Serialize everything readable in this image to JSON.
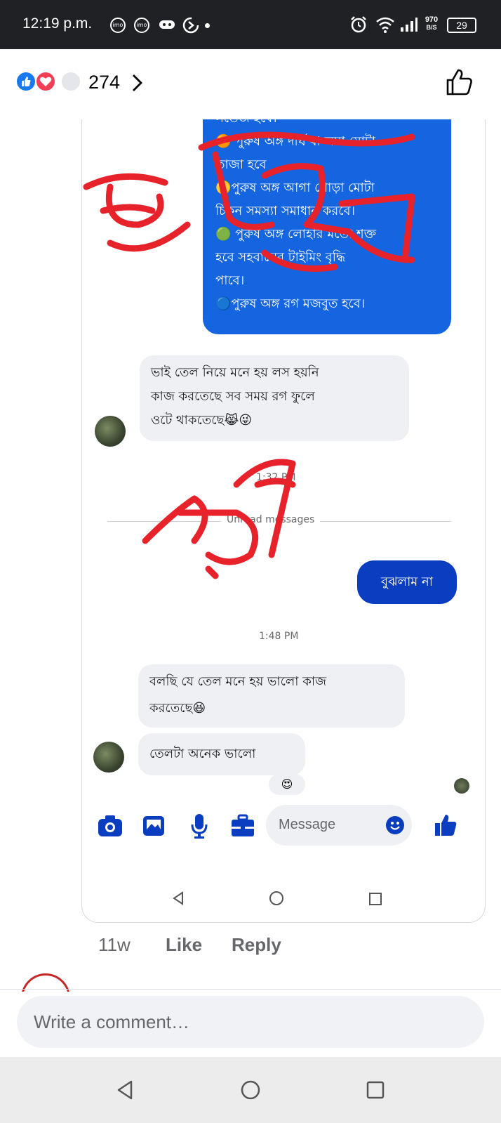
{
  "status_bar": {
    "time": "12:19 p.m.",
    "net_speed_value": "970",
    "net_speed_unit": "B/S",
    "battery": "29"
  },
  "reactions": {
    "count": "274",
    "types": [
      "like",
      "love",
      "other"
    ]
  },
  "screenshot": {
    "blue_message_lines": [
      "সতেজ হবে।",
      "🟠 পুরুষ অঙ্গ দীর্ঘ বা লম্বা মোটা",
      "তাজা হবে",
      "🟡পুরুষ অঙ্গ আগা গোড়া মোটা",
      "চিকন সমস্যা সমাধান করবে।",
      "🟢 পুরুষ অঙ্গ লোহার মতো শক্ত",
      "হবে সহবাসের টাইমিং বৃদ্ধি",
      "পাবে।",
      "🔵পুরুষ অঙ্গ রগ মজবুত হবে।"
    ],
    "received_1_lines": [
      "ভাই তেল নিয়ে মনে হয় লস হয়নি",
      "কাজ করতেছে সব সময় রগ ফুলে",
      "ওটে থাকতেছে😹😜"
    ],
    "timestamp_1": "1:32 PM",
    "divider_text": "Unread messages",
    "sent_message": "বুঝলাম না",
    "timestamp_2": "1:48 PM",
    "received_2_lines": [
      "বলছি যে তেল মনে হয় ভালো কাজ",
      "করতেছে😆"
    ],
    "received_3": "তেলটা অনেক ভালো",
    "reaction_emoji": "😍",
    "composer_placeholder": "Message",
    "annotations": {
      "top_word": "জোকের",
      "top_word_2": "তেল",
      "bottom_word": "ঘর"
    }
  },
  "comment_actions": {
    "age": "11w",
    "like": "Like",
    "reply": "Reply"
  },
  "comment_box": {
    "placeholder": "Write a comment…"
  },
  "colors": {
    "messenger_blue": "#1565e0",
    "sent_bubble": "#0a3dbf",
    "annotation_red": "#e8222b",
    "like_blue": "#1877f2",
    "love_red": "#f33e58"
  }
}
